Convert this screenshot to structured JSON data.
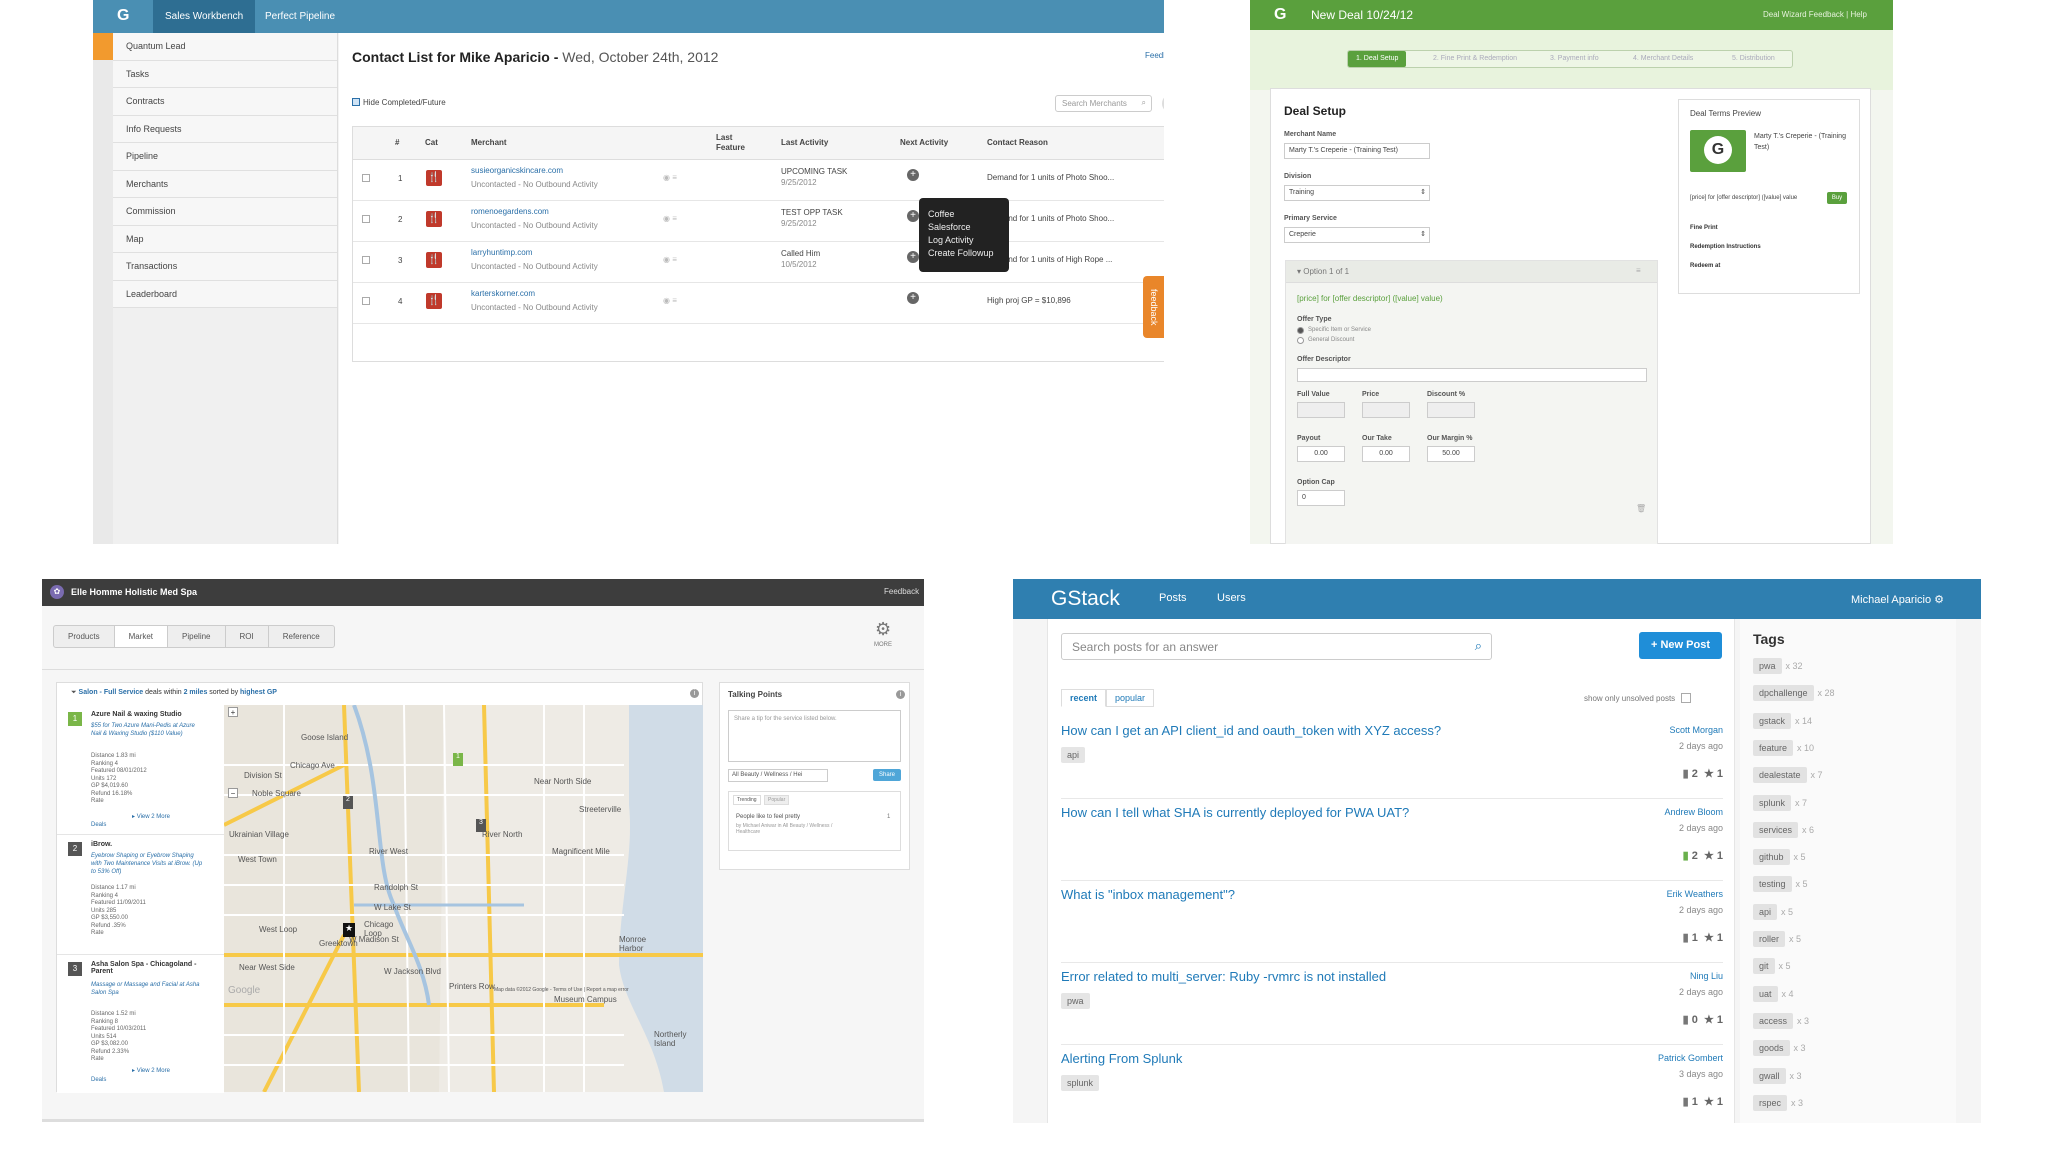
{
  "p1": {
    "logo": "G",
    "tabs": [
      "Sales Workbench",
      "Perfect Pipeline"
    ],
    "sidebar": [
      "Quantum Lead",
      "Tasks",
      "Contracts",
      "Info Requests",
      "Pipeline",
      "Merchants",
      "Commission",
      "Map",
      "Transactions",
      "Leaderboard"
    ],
    "title": "Contact List for Mike Aparicio -",
    "date": "Wed, October 24th, 2012",
    "feedback_link": "Feedback on Call List",
    "hide_label": "Hide Completed/Future",
    "search_placeholder": "Search Merchants",
    "columns": [
      "#",
      "Cat",
      "Merchant",
      "Last Feature",
      "Last Activity",
      "Next Activity",
      "Contact Reason"
    ],
    "rows": [
      {
        "n": "1",
        "merchant": "susieorganicskincare.com",
        "status": "Uncontacted - No Outbound Activity",
        "last_act": "UPCOMING TASK",
        "last_date": "9/25/2012",
        "reason": "Demand for 1 units of Photo Shoo..."
      },
      {
        "n": "2",
        "merchant": "romenoegardens.com",
        "status": "Uncontacted - No Outbound Activity",
        "last_act": "TEST OPP TASK",
        "last_date": "9/25/2012",
        "reason": "Demand for 1 units of Photo Shoo..."
      },
      {
        "n": "3",
        "merchant": "larryhuntimp.com",
        "status": "Uncontacted - No Outbound Activity",
        "last_act": "Called Him",
        "last_date": "10/5/2012",
        "reason": "Demand for 1 units of High Rope ..."
      },
      {
        "n": "4",
        "merchant": "karterskorner.com",
        "status": "Uncontacted - No Outbound Activity",
        "last_act": "",
        "last_date": "",
        "reason": "High proj GP = $10,896"
      }
    ],
    "popup": [
      "Coffee",
      "Salesforce",
      "Log Activity",
      "Create Followup"
    ],
    "feedback_tab": "feedback"
  },
  "p2": {
    "logo": "G",
    "title": "New Deal 10/24/12",
    "toplinks": "Deal Wizard Feedback | Help",
    "steps": [
      "1. Deal Setup",
      "2. Fine Print & Redemption",
      "3. Payment info",
      "4. Merchant Details",
      "5. Distribution"
    ],
    "heading": "Deal Setup",
    "merchant_name_label": "Merchant Name",
    "merchant_name": "Marty T.'s Creperie - (Training Test)",
    "division_label": "Division",
    "division": "Training",
    "primary_service_label": "Primary Service",
    "primary_service": "Creperie",
    "option_header": "Option 1 of 1",
    "option_template": "[price] for [offer descriptor] ([value] value)",
    "offer_type_label": "Offer Type",
    "offer_types": [
      "Specific Item or Service",
      "General Discount"
    ],
    "offer_descriptor_label": "Offer Descriptor",
    "full_value_label": "Full Value",
    "price_label": "Price",
    "discount_label": "Discount %",
    "payout_label": "Payout",
    "our_take_label": "Our Take",
    "our_margin_label": "Our Margin %",
    "payout": "0.00",
    "our_take": "0.00",
    "our_margin": "50.00",
    "option_cap_label": "Option Cap",
    "option_cap": "0",
    "preview_title": "Deal Terms Preview",
    "preview_merchant": "Marty T.'s Creperie - (Training Test)",
    "preview_template": "[price] for [offer descriptor] ([value] value",
    "buy": "Buy",
    "fine_print": "Fine Print",
    "redemption_instructions": "Redemption Instructions",
    "redeem_at": "Redeem at"
  },
  "p3": {
    "title": "Elle Homme Holistic Med Spa",
    "feedback": "Feedback",
    "tabs": [
      "Products",
      "Market",
      "Pipeline",
      "ROI",
      "Reference"
    ],
    "more": "MORE",
    "filter_pre": "Salon - Full Service",
    "filter_mid": " deals within ",
    "filter_miles": "2 miles",
    "filter_post": " sorted by ",
    "filter_sort": "highest GP",
    "listings": [
      {
        "n": "1",
        "name": "Azure Nail & waxing Studio",
        "deal": "$55 for Two Azure Mani-Pedis at Azure Nail & Waxing Studio ($110 Value)",
        "stats": [
          "Distance 1.83 mi",
          "Ranking 4",
          "Featured 08/01/2012",
          "Units 172",
          "GP $4,019.60",
          "Refund 16.18%",
          "Rate"
        ],
        "more": "View 2 More",
        "deals": "Deals"
      },
      {
        "n": "2",
        "name": "iBrow.",
        "deal": "Eyebrow Shaping or Eyebrow Shaping with Two Maintenance Visits at iBrow. (Up to 53% Off)",
        "stats": [
          "Distance 1.17 mi",
          "Ranking 4",
          "Featured 11/09/2011",
          "Units 285",
          "GP $3,550.00",
          "Refund .35%",
          "Rate"
        ]
      },
      {
        "n": "3",
        "name": "Asha Salon Spa - Chicagoland - Parent",
        "deal": "Massage or Massage and Facial at Asha Salon Spa",
        "stats": [
          "Distance 1.52 mi",
          "Ranking 8",
          "Featured 10/03/2011",
          "Units 514",
          "GP $3,082.00",
          "Refund 2.33%",
          "Rate"
        ],
        "more": "View 2 More",
        "deals": "Deals"
      }
    ],
    "map_labels": [
      "Goose Island",
      "Chicago Ave",
      "Noble Square",
      "West Town",
      "Division St",
      "Ukrainian Village",
      "River West",
      "Streeterville",
      "River North",
      "Magnificent Mile",
      "Near North Side",
      "Randolph St",
      "W Lake St",
      "W Madison St",
      "W Jackson Blvd",
      "Greektown",
      "West Loop",
      "Chicago Loop",
      "Printers Row",
      "Near West Side",
      "Museum Campus",
      "Monroe Harbor",
      "Northerly Island"
    ],
    "map_footer": "Map data ©2012 Google - Terms of Use | Report a map error",
    "google": "Google",
    "talk_title": "Talking Points",
    "talk_placeholder": "Share a tip for the service listed below.",
    "talk_select": "All Beauty / Wellness / Hei",
    "share": "Share",
    "talk_tabs": [
      "Trending",
      "Popular"
    ],
    "talk_item": "People like to feel pretty",
    "talk_meta": "by Michael Aniwar in All Beauty / Wellness / Healthcare",
    "talk_count": "1"
  },
  "p4": {
    "logo": "GStack",
    "nav": [
      "Posts",
      "Users"
    ],
    "user": "Michael Aparicio",
    "search_placeholder": "Search posts for an answer",
    "new_post": "+ New Post",
    "tabs": [
      "recent",
      "popular"
    ],
    "unsolved": "show only unsolved posts",
    "posts": [
      {
        "q": "How can I get an API client_id and oauth_token with XYZ access?",
        "author": "Scott Morgan",
        "ago": "2 days ago",
        "tag": "api",
        "answers": "2",
        "stars": "1",
        "answered": false
      },
      {
        "q": "How can I tell what SHA is currently deployed for PWA UAT?",
        "author": "Andrew Bloom",
        "ago": "2 days ago",
        "tag": "",
        "answers": "2",
        "stars": "1",
        "answered": true
      },
      {
        "q": "What is \"inbox management\"?",
        "author": "Erik Weathers",
        "ago": "2 days ago",
        "tag": "",
        "answers": "1",
        "stars": "1",
        "answered": false
      },
      {
        "q": "Error related to multi_server: Ruby -rvmrc is not installed",
        "author": "Ning Liu",
        "ago": "2 days ago",
        "tag": "pwa",
        "answers": "0",
        "stars": "1",
        "answered": false
      },
      {
        "q": "Alerting From Splunk",
        "author": "Patrick Gombert",
        "ago": "3 days ago",
        "tag": "splunk",
        "answers": "1",
        "stars": "1",
        "answered": false
      }
    ],
    "tags_title": "Tags",
    "tags": [
      {
        "name": "pwa",
        "count": "x 32"
      },
      {
        "name": "dpchallenge",
        "count": "x 28"
      },
      {
        "name": "gstack",
        "count": "x 14"
      },
      {
        "name": "feature",
        "count": "x 10"
      },
      {
        "name": "dealestate",
        "count": "x 7"
      },
      {
        "name": "splunk",
        "count": "x 7"
      },
      {
        "name": "services",
        "count": "x 6"
      },
      {
        "name": "github",
        "count": "x 5"
      },
      {
        "name": "testing",
        "count": "x 5"
      },
      {
        "name": "api",
        "count": "x 5"
      },
      {
        "name": "roller",
        "count": "x 5"
      },
      {
        "name": "git",
        "count": "x 5"
      },
      {
        "name": "uat",
        "count": "x 4"
      },
      {
        "name": "access",
        "count": "x 3"
      },
      {
        "name": "goods",
        "count": "x 3"
      },
      {
        "name": "gwall",
        "count": "x 3"
      },
      {
        "name": "rspec",
        "count": "x 3"
      }
    ]
  }
}
